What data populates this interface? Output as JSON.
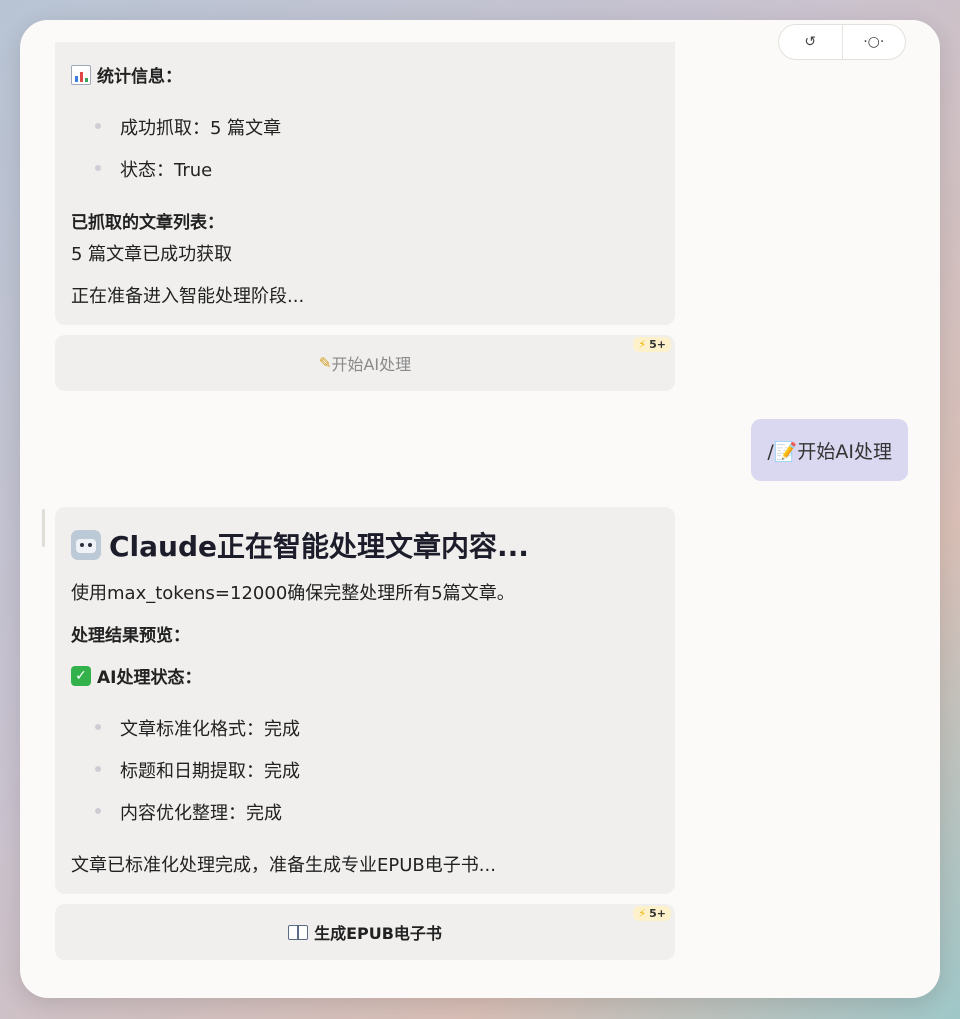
{
  "top_pill": {
    "left": "↺",
    "right": "·○·"
  },
  "card1": {
    "stats_title": "统计信息：",
    "items": [
      "成功抓取：5 篇文章",
      "状态：True"
    ],
    "list_title": "已抓取的文章列表：",
    "list_text": "5 篇文章已成功获取",
    "footer": "正在准备进入智能处理阶段..."
  },
  "button1": {
    "label": "开始AI处理",
    "badge": "5+",
    "text_color": "#8a8a8a"
  },
  "user_message": {
    "text": "/📝开始AI处理"
  },
  "card2": {
    "title": "Claude正在智能处理文章内容...",
    "desc": "使用max_tokens=12000确保完整处理所有5篇文章。",
    "preview_title": "处理结果预览：",
    "status_title": "AI处理状态：",
    "items": [
      "文章标准化格式：完成",
      "标题和日期提取：完成",
      "内容优化整理：完成"
    ],
    "footer": "文章已标准化处理完成，准备生成专业EPUB电子书..."
  },
  "button2": {
    "label": "生成EPUB电子书",
    "badge": "5+",
    "text_color": "#222222"
  },
  "colors": {
    "user_bubble": "#dad7f0",
    "card_bg": "#f0efed",
    "badge_bg": "#fdf1cc",
    "bolt": "#f2b400"
  },
  "icons": [
    "bar-chart-icon",
    "check-icon",
    "robot-icon",
    "memo-icon",
    "book-icon",
    "lightning-icon"
  ]
}
